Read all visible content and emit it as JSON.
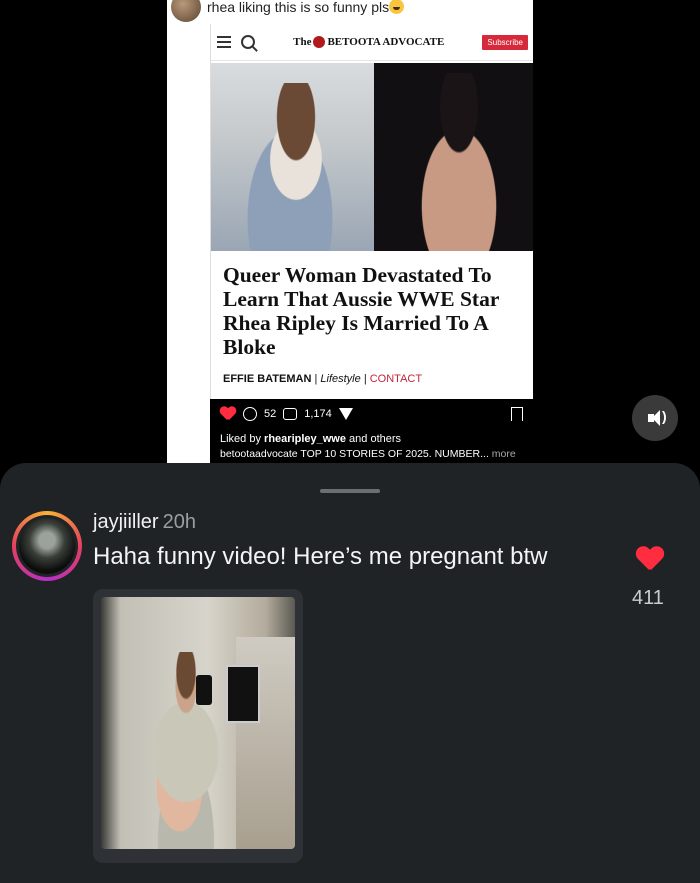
{
  "reel": {
    "caption": "rhea liking this is so funny pls",
    "article": {
      "site_prefix": "The",
      "site_name": "BETOOTA ADVOCATE",
      "subscribe_label": "Subscribe",
      "headline": "Queer Woman Devastated To Learn That Aussie WWE Star Rhea Ripley Is Married To A Bloke",
      "author": "EFFIE BATEMAN",
      "section": "Lifestyle",
      "contact": "CONTACT",
      "sep": "|"
    },
    "actions": {
      "comments": "52",
      "reposts": "1,174"
    },
    "liked_prefix": "Liked by",
    "liked_user": "rhearipley_wwe",
    "liked_suffix": "and others",
    "post_caption": "betootaadvocate TOP 10 STORIES OF 2025. NUMBER...",
    "more": "more"
  },
  "comment": {
    "username": "jayjiiller",
    "time": "20h",
    "text": "Haha funny video! Here’s me pregnant btw",
    "like_count": "411"
  },
  "icons": [
    "heart-icon",
    "comment-icon",
    "repost-icon",
    "share-icon",
    "bookmark-icon",
    "sound-icon",
    "search-icon",
    "menu-icon"
  ]
}
